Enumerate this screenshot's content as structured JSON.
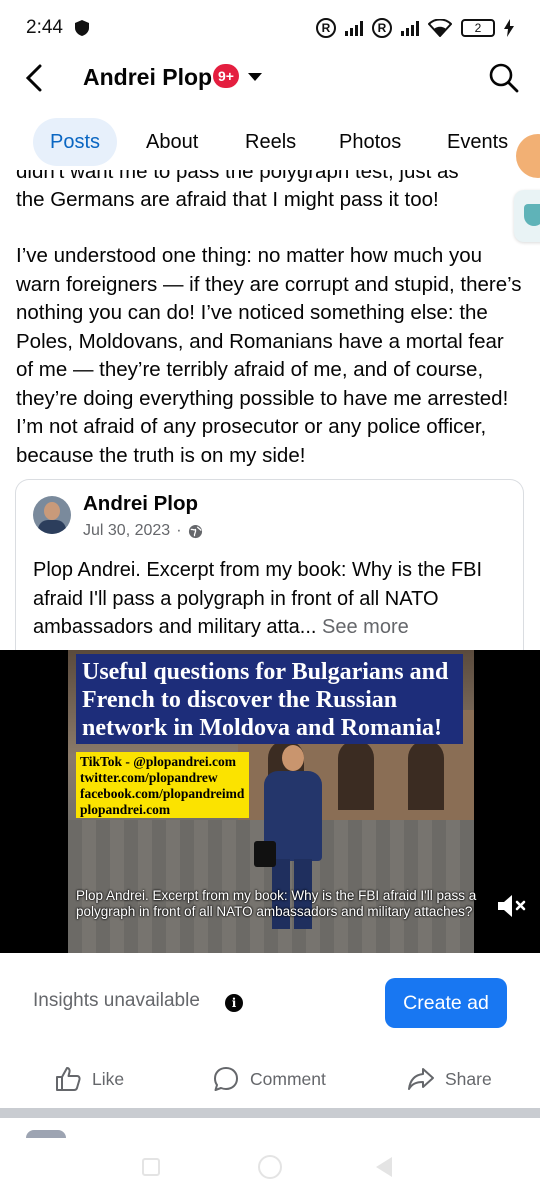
{
  "status_bar": {
    "time": "2:44",
    "battery": "2"
  },
  "header": {
    "page_name": "Andrei Plop",
    "notification_badge": "9+"
  },
  "tabs": [
    {
      "label": "Posts",
      "active": true
    },
    {
      "label": "About",
      "active": false
    },
    {
      "label": "Reels",
      "active": false
    },
    {
      "label": "Photos",
      "active": false
    },
    {
      "label": "Events",
      "active": false
    }
  ],
  "post": {
    "clipped_line": "didn't want me to pass the polygraph test, just as",
    "paragraph_1": "the Germans are afraid that I might pass it too!",
    "paragraph_2": "I’ve understood one thing: no matter how much you warn foreigners — if they are corrupt and stupid, there’s nothing you can do! I’ve noticed something else: the Poles, Moldovans, and Romanians have a mortal fear of me — they’re terribly afraid of me, and of course, they’re doing everything possible to have me arrested! I’m not afraid of any prosecutor or any police officer, because the truth is on my side!"
  },
  "shared_post": {
    "author": "Andrei Plop",
    "date": "Jul 30, 2023",
    "separator": "·",
    "text": "Plop Andrei. Excerpt from my book: Why is the FBI afraid I'll pass a polygraph in front of all NATO ambassadors and military atta...",
    "see_more": "See more"
  },
  "video": {
    "headline": "Useful questions for Bulgarians and French to discover the Russian network in Moldova and Romania!",
    "links": [
      "TikTok - @plopandrei.com",
      "twitter.com/plopandrew",
      "facebook.com/plopandreimd",
      "plopandrei.com"
    ],
    "caption": "Plop Andrei. Excerpt from my book: Why is the FBI afraid I'll pass a polygraph in front of all NATO ambassadors and military attaches?"
  },
  "insights": {
    "label": "Insights unavailable",
    "create_ad": "Create ad"
  },
  "actions": {
    "like": "Like",
    "comment": "Comment",
    "share": "Share"
  },
  "colors": {
    "accent": "#1877f2",
    "active_tab_bg": "#e7f0fb",
    "active_tab_text": "#0a66c2",
    "badge": "#e41e3f",
    "headline_bg": "#1d2d7a",
    "links_bg": "#fbe300"
  },
  "icons": {
    "back": "arrow-left-icon",
    "search": "search-icon",
    "globe": "globe-icon",
    "mute": "speaker-muted-icon",
    "info": "info-icon",
    "like": "thumbs-up-icon",
    "comment": "speech-bubble-icon",
    "share": "share-arrow-icon"
  }
}
